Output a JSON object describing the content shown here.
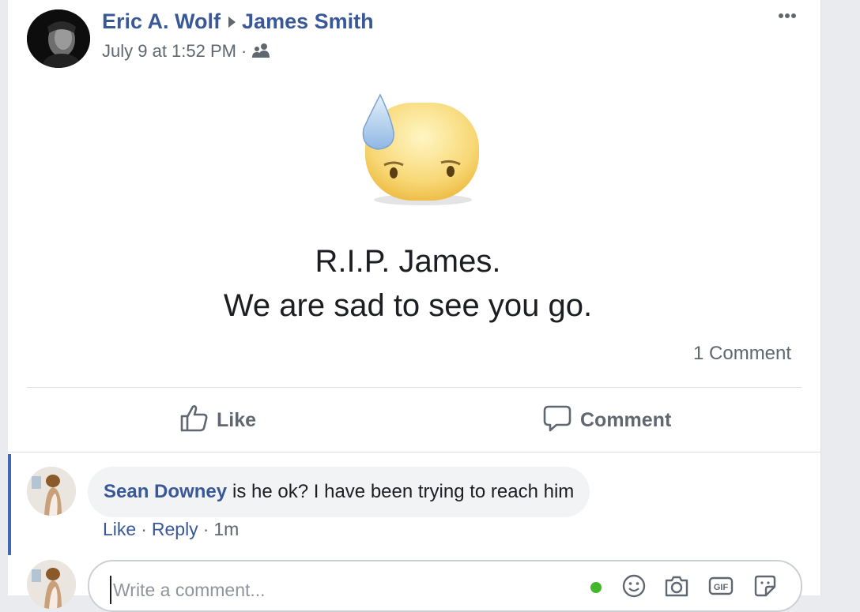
{
  "post": {
    "author": "Eric A. Wolf",
    "recipient": "James Smith",
    "timestamp": "July 9 at 1:52 PM",
    "separator": "·",
    "audience_icon": "friends-icon",
    "text_line1": "R.I.P. James.",
    "text_line2": "We are sad to see you go.",
    "emoji_icon": "sad-sweat-emoji",
    "comment_count": "1 Comment"
  },
  "actions": {
    "like_label": "Like",
    "comment_label": "Comment"
  },
  "comments": [
    {
      "author": "Sean Downey",
      "text": "is he ok? I have been trying to reach him",
      "like_label": "Like",
      "reply_label": "Reply",
      "time": "1m",
      "sep": "·"
    }
  ],
  "composer": {
    "placeholder": "Write a comment..."
  },
  "colors": {
    "link": "#385898",
    "secondary": "#606770",
    "online": "#42b72a",
    "accent_bar": "#4267b2"
  }
}
